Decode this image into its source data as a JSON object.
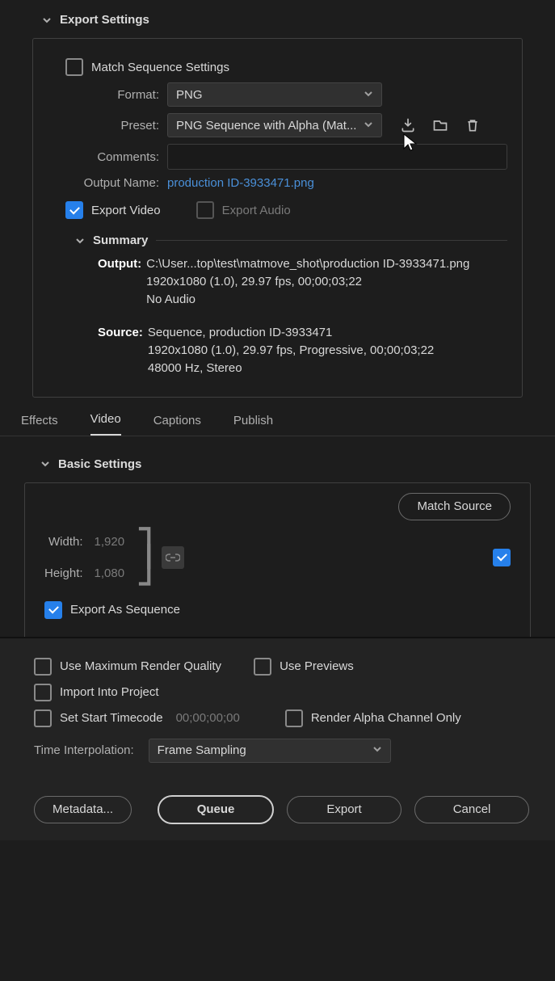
{
  "exportSettings": {
    "title": "Export Settings",
    "matchSequence": "Match Sequence Settings",
    "formatLabel": "Format:",
    "formatValue": "PNG",
    "presetLabel": "Preset:",
    "presetValue": "PNG Sequence with Alpha (Mat...",
    "commentsLabel": "Comments:",
    "commentsValue": "",
    "outputNameLabel": "Output Name:",
    "outputNameValue": "production ID-3933471.png",
    "exportVideo": "Export Video",
    "exportAudio": "Export Audio"
  },
  "summary": {
    "title": "Summary",
    "outputLabel": "Output:",
    "outputLine1": "C:\\User...top\\test\\matmove_shot\\production ID-3933471.png",
    "outputLine2": "1920x1080 (1.0), 29.97 fps, 00;00;03;22",
    "outputLine3": "No Audio",
    "sourceLabel": "Source:",
    "sourceLine1": "Sequence, production ID-3933471",
    "sourceLine2": "1920x1080 (1.0), 29.97 fps, Progressive, 00;00;03;22",
    "sourceLine3": "48000 Hz, Stereo"
  },
  "tabs": {
    "effects": "Effects",
    "video": "Video",
    "captions": "Captions",
    "publish": "Publish"
  },
  "basic": {
    "title": "Basic Settings",
    "matchSource": "Match Source",
    "widthLabel": "Width:",
    "widthValue": "1,920",
    "heightLabel": "Height:",
    "heightValue": "1,080",
    "exportAsSequence": "Export As Sequence"
  },
  "bottom": {
    "useMaxRender": "Use Maximum Render Quality",
    "usePreviews": "Use Previews",
    "importIntoProject": "Import Into Project",
    "setStartTimecode": "Set Start Timecode",
    "timecodeValue": "00;00;00;00",
    "renderAlphaOnly": "Render Alpha Channel Only",
    "timeInterpLabel": "Time Interpolation:",
    "timeInterpValue": "Frame Sampling",
    "metadata": "Metadata...",
    "queue": "Queue",
    "export": "Export",
    "cancel": "Cancel"
  }
}
